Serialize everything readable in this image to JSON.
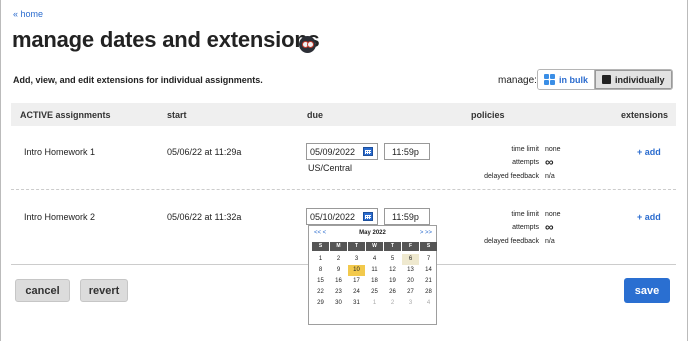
{
  "nav": {
    "home_link": "« home"
  },
  "page": {
    "title": "manage dates and extensions",
    "owl_icon": "owl-icon",
    "description": "Add, view, and edit extensions for individual assignments."
  },
  "manage": {
    "label": "manage:",
    "options": [
      {
        "label": "in bulk",
        "icon": "grid-icon",
        "selected": false
      },
      {
        "label": "individually",
        "icon": "square-icon",
        "selected": true
      }
    ]
  },
  "table": {
    "headers": {
      "assignments": "ACTIVE assignments",
      "start": "start",
      "due": "due",
      "policies": "policies",
      "extensions": "extensions"
    },
    "rows": [
      {
        "name": "Intro Homework 1",
        "start": "05/06/22 at 11:29a",
        "due_date": "05/09/2022",
        "due_time": "11:59p",
        "timezone": "US/Central",
        "time_limit_label": "time limit",
        "time_limit_value": "none",
        "attempts_label": "attempts",
        "attempts_value": "∞",
        "feedback_label": "delayed feedback",
        "feedback_value": "n/a",
        "add_label": "+ add"
      },
      {
        "name": "Intro Homework 2",
        "start": "05/06/22 at 11:32a",
        "due_date": "05/10/2022",
        "due_time": "11:59p",
        "time_limit_label": "time limit",
        "time_limit_value": "none",
        "attempts_label": "attempts",
        "attempts_value": "∞",
        "feedback_label": "delayed feedback",
        "feedback_value": "n/a",
        "add_label": "+ add"
      }
    ]
  },
  "calendar": {
    "prev_label": "<< <",
    "next_label": "> >>",
    "month": "May 2022",
    "weekdays": [
      "S",
      "M",
      "T",
      "W",
      "T",
      "F",
      "S"
    ],
    "weeks": [
      [
        "1",
        "2",
        "3",
        "4",
        "5",
        "6",
        "7"
      ],
      [
        "8",
        "9",
        "10",
        "11",
        "12",
        "13",
        "14"
      ],
      [
        "15",
        "16",
        "17",
        "18",
        "19",
        "20",
        "21"
      ],
      [
        "22",
        "23",
        "24",
        "25",
        "26",
        "27",
        "28"
      ],
      [
        "29",
        "30",
        "31",
        "1",
        "2",
        "3",
        "4"
      ]
    ],
    "today_day": "6",
    "selected_day": "10"
  },
  "actions": {
    "cancel": "cancel",
    "revert": "revert",
    "save": "save"
  },
  "colors": {
    "accent": "#2b6ccf",
    "save_button": "#2a6fd1",
    "today_highlight": "#f2c94c",
    "selected_day": "#efe9cf"
  }
}
